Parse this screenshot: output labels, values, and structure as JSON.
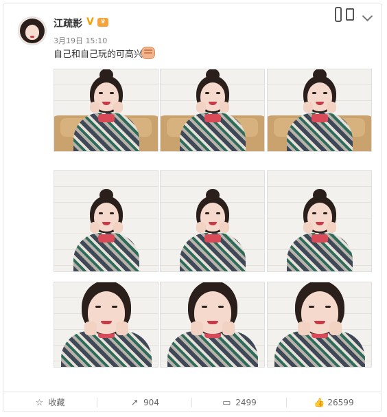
{
  "post": {
    "username": "江疏影",
    "verify_badge": "V",
    "timestamp": "3月19日 15:10",
    "text": "自己和自己玩的可高兴"
  },
  "footer": {
    "favorite_label": "收藏",
    "repost_count": "904",
    "comment_count": "2499",
    "like_count": "26599"
  },
  "icons": {
    "favorite": "star-outline-icon",
    "repost": "share-arrow-icon",
    "comment": "comment-bubble-icon",
    "like": "thumb-up-icon",
    "more": "chevron-down-icon"
  },
  "colors": {
    "text": "#333333",
    "muted": "#808080",
    "border": "#e4e4e4",
    "verify": "#f0a000"
  }
}
